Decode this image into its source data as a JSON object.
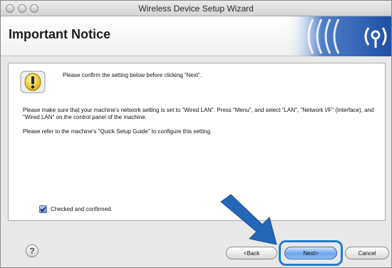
{
  "window": {
    "title": "Wireless Device Setup Wizard"
  },
  "header": {
    "title": "Important Notice"
  },
  "notice": {
    "lead": "Please confirm the setting below before clicking \"Next\".",
    "paragraphs": [
      "Please make sure that your machine's network setting is set to \"Wired LAN\". Press \"Menu\", and select \"LAN\", \"Network I/F\" (Interface), and \"Wired LAN\" on the control panel of the machine.",
      "Please refer to the machine's \"Quick Setup Guide\" to configure this setting."
    ]
  },
  "checkbox": {
    "label": "Checked and confirmed.",
    "checked": true
  },
  "buttons": {
    "help": "?",
    "back": "<Back",
    "next": "Next>",
    "cancel": "Cancel"
  },
  "colors": {
    "accent": "#1e7bd4",
    "logo_blue": "#1f4fa3",
    "warning": "#f2c200"
  },
  "icons": {
    "warning": "warning-icon",
    "logo": "wireless-logo-icon",
    "arrow": "pointer-arrow-icon"
  }
}
